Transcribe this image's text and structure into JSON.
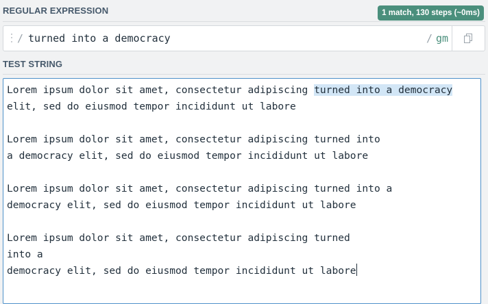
{
  "regex_section": {
    "label": "REGULAR EXPRESSION",
    "match_info": "1 match, 130 steps (~0ms)",
    "delimiter_open": "/",
    "pattern": "turned into a democracy",
    "delimiter_close": "/",
    "flags": "gm",
    "copy_icon": "copy-icon"
  },
  "test_section": {
    "label": "TEST STRING",
    "lines": [
      {
        "before": "Lorem ipsum dolor sit amet, consectetur adipiscing ",
        "match": "turned into a democracy",
        "after": ""
      },
      {
        "before": "elit, sed do eiusmod tempor incididunt ut labore",
        "match": "",
        "after": ""
      },
      {
        "before": "",
        "match": "",
        "after": ""
      },
      {
        "before": "Lorem ipsum dolor sit amet, consectetur adipiscing turned into",
        "match": "",
        "after": ""
      },
      {
        "before": "a democracy elit, sed do eiusmod tempor incididunt ut labore",
        "match": "",
        "after": ""
      },
      {
        "before": "",
        "match": "",
        "after": ""
      },
      {
        "before": "Lorem ipsum dolor sit amet, consectetur adipiscing turned into a",
        "match": "",
        "after": ""
      },
      {
        "before": "democracy elit, sed do eiusmod tempor incididunt ut labore",
        "match": "",
        "after": ""
      },
      {
        "before": "",
        "match": "",
        "after": ""
      },
      {
        "before": "Lorem ipsum dolor sit amet, consectetur adipiscing turned",
        "match": "",
        "after": ""
      },
      {
        "before": "into a",
        "match": "",
        "after": ""
      },
      {
        "before": "democracy elit, sed do eiusmod tempor incididunt ut labore",
        "match": "",
        "after": ""
      }
    ],
    "highlight_color": "#d2e6f6"
  },
  "colors": {
    "badge": "#4a8f7c",
    "flags": "#4a8f7c",
    "focus_border": "#4d90c9",
    "label": "#46596b"
  }
}
